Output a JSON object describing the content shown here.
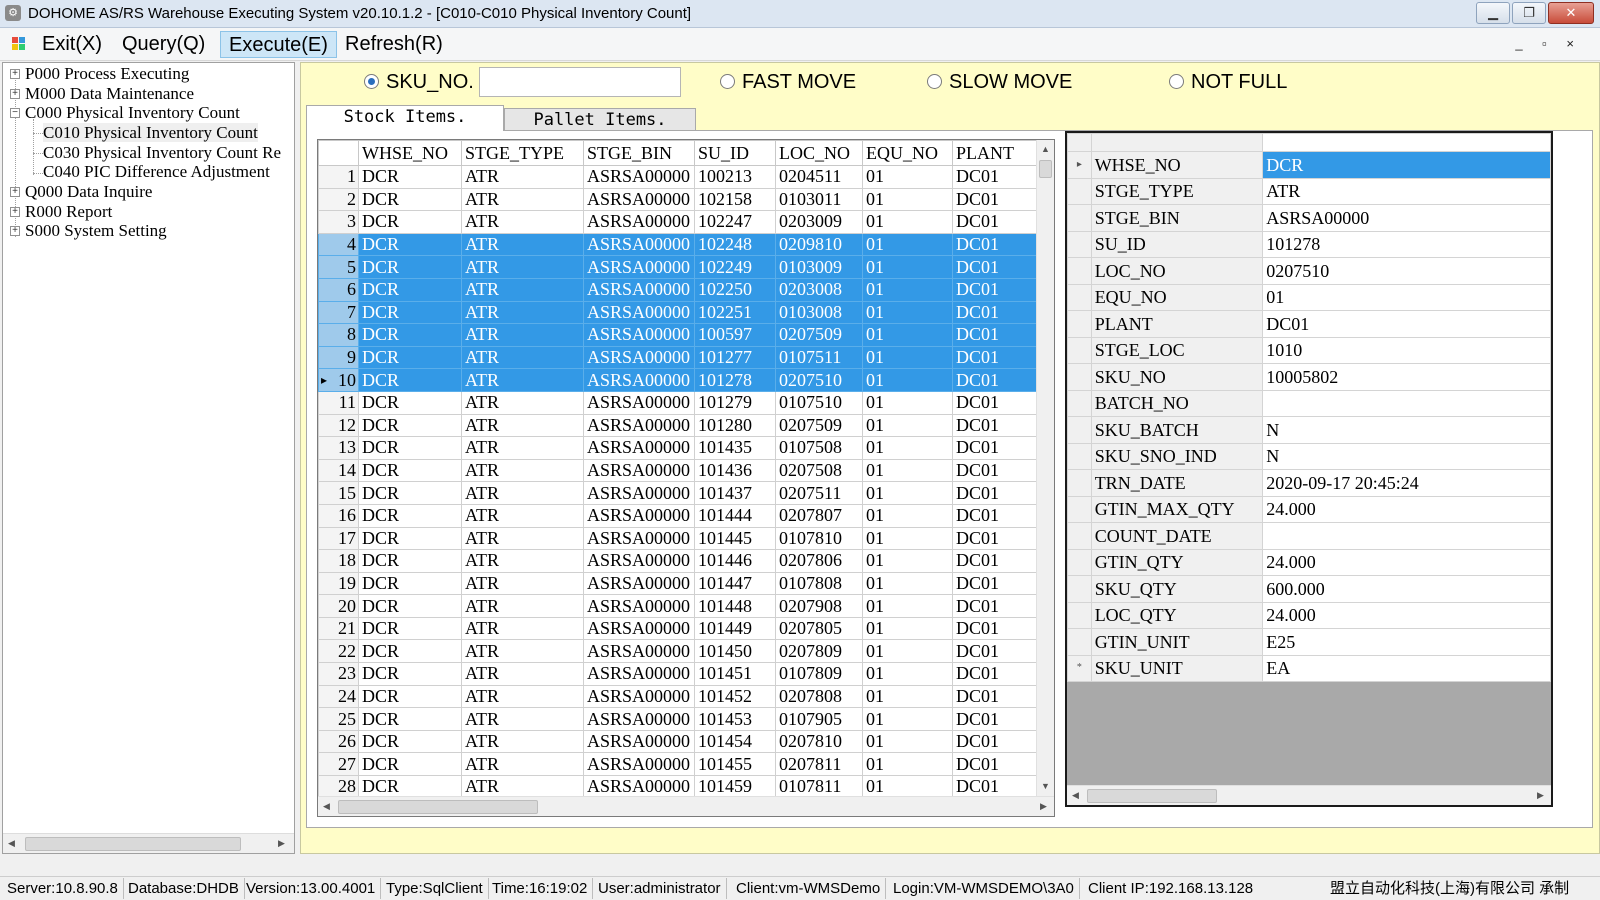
{
  "window": {
    "title": "DOHOME AS/RS Warehouse Executing System v20.10.1.2 - [C010-C010 Physical Inventory Count]",
    "app_icon": "app-logo-icon",
    "buttons": {
      "minimize": "minimize-icon",
      "maximize": "restore-icon",
      "close": "close-icon"
    }
  },
  "menu": {
    "icon": "menu-app-icon",
    "items": [
      {
        "label": "Exit(X)"
      },
      {
        "label": "Query(Q)"
      },
      {
        "label": "Execute(E)",
        "active": true
      },
      {
        "label": "Refresh(R)"
      }
    ],
    "mdi_controls": "_ ▫ ×"
  },
  "tree": {
    "nodes": [
      {
        "label": "P000 Process Executing",
        "expander": "+"
      },
      {
        "label": "M000 Data Maintenance",
        "expander": "+"
      },
      {
        "label": "C000 Physical Inventory Count",
        "expander": "−"
      },
      {
        "label": "C010 Physical Inventory Count",
        "child": true
      },
      {
        "label": "C030 Physical Inventory Count Re",
        "child": true
      },
      {
        "label": "C040 PIC Difference Adjustment",
        "child": true
      },
      {
        "label": "Q000 Data Inquire",
        "expander": "+"
      },
      {
        "label": "R000 Report",
        "expander": "+"
      },
      {
        "label": "S000 System Setting",
        "expander": "+"
      }
    ]
  },
  "filters": {
    "sku_no": {
      "label": "SKU_NO.",
      "checked": true,
      "value": ""
    },
    "fast_move": {
      "label": "FAST MOVE",
      "checked": false
    },
    "slow_move": {
      "label": "SLOW MOVE",
      "checked": false
    },
    "not_full": {
      "label": "NOT FULL",
      "checked": false
    }
  },
  "tabs": [
    {
      "label": "Stock Items.",
      "active": true
    },
    {
      "label": "Pallet Items.",
      "active": false
    }
  ],
  "grid": {
    "columns": [
      "WHSE_NO",
      "STGE_TYPE",
      "STGE_BIN",
      "SU_ID",
      "LOC_NO",
      "EQU_NO",
      "PLANT"
    ],
    "current_row_marker": "▸",
    "rows": [
      {
        "n": "1",
        "selected": false,
        "cells": [
          "DCR",
          "ATR",
          "ASRSA00000",
          "100213",
          "0204511",
          "01",
          "DC01"
        ]
      },
      {
        "n": "2",
        "selected": false,
        "cells": [
          "DCR",
          "ATR",
          "ASRSA00000",
          "102158",
          "0103011",
          "01",
          "DC01"
        ]
      },
      {
        "n": "3",
        "selected": false,
        "cells": [
          "DCR",
          "ATR",
          "ASRSA00000",
          "102247",
          "0203009",
          "01",
          "DC01"
        ]
      },
      {
        "n": "4",
        "selected": true,
        "cells": [
          "DCR",
          "ATR",
          "ASRSA00000",
          "102248",
          "0209810",
          "01",
          "DC01"
        ]
      },
      {
        "n": "5",
        "selected": true,
        "cells": [
          "DCR",
          "ATR",
          "ASRSA00000",
          "102249",
          "0103009",
          "01",
          "DC01"
        ]
      },
      {
        "n": "6",
        "selected": true,
        "cells": [
          "DCR",
          "ATR",
          "ASRSA00000",
          "102250",
          "0203008",
          "01",
          "DC01"
        ]
      },
      {
        "n": "7",
        "selected": true,
        "cells": [
          "DCR",
          "ATR",
          "ASRSA00000",
          "102251",
          "0103008",
          "01",
          "DC01"
        ]
      },
      {
        "n": "8",
        "selected": true,
        "cells": [
          "DCR",
          "ATR",
          "ASRSA00000",
          "100597",
          "0207509",
          "01",
          "DC01"
        ]
      },
      {
        "n": "9",
        "selected": true,
        "cells": [
          "DCR",
          "ATR",
          "ASRSA00000",
          "101277",
          "0107511",
          "01",
          "DC01"
        ]
      },
      {
        "n": "10",
        "selected": true,
        "current": true,
        "cells": [
          "DCR",
          "ATR",
          "ASRSA00000",
          "101278",
          "0207510",
          "01",
          "DC01"
        ]
      },
      {
        "n": "11",
        "selected": false,
        "cells": [
          "DCR",
          "ATR",
          "ASRSA00000",
          "101279",
          "0107510",
          "01",
          "DC01"
        ]
      },
      {
        "n": "12",
        "selected": false,
        "cells": [
          "DCR",
          "ATR",
          "ASRSA00000",
          "101280",
          "0207509",
          "01",
          "DC01"
        ]
      },
      {
        "n": "13",
        "selected": false,
        "cells": [
          "DCR",
          "ATR",
          "ASRSA00000",
          "101435",
          "0107508",
          "01",
          "DC01"
        ]
      },
      {
        "n": "14",
        "selected": false,
        "cells": [
          "DCR",
          "ATR",
          "ASRSA00000",
          "101436",
          "0207508",
          "01",
          "DC01"
        ]
      },
      {
        "n": "15",
        "selected": false,
        "cells": [
          "DCR",
          "ATR",
          "ASRSA00000",
          "101437",
          "0207511",
          "01",
          "DC01"
        ]
      },
      {
        "n": "16",
        "selected": false,
        "cells": [
          "DCR",
          "ATR",
          "ASRSA00000",
          "101444",
          "0207807",
          "01",
          "DC01"
        ]
      },
      {
        "n": "17",
        "selected": false,
        "cells": [
          "DCR",
          "ATR",
          "ASRSA00000",
          "101445",
          "0107810",
          "01",
          "DC01"
        ]
      },
      {
        "n": "18",
        "selected": false,
        "cells": [
          "DCR",
          "ATR",
          "ASRSA00000",
          "101446",
          "0207806",
          "01",
          "DC01"
        ]
      },
      {
        "n": "19",
        "selected": false,
        "cells": [
          "DCR",
          "ATR",
          "ASRSA00000",
          "101447",
          "0107808",
          "01",
          "DC01"
        ]
      },
      {
        "n": "20",
        "selected": false,
        "cells": [
          "DCR",
          "ATR",
          "ASRSA00000",
          "101448",
          "0207908",
          "01",
          "DC01"
        ]
      },
      {
        "n": "21",
        "selected": false,
        "cells": [
          "DCR",
          "ATR",
          "ASRSA00000",
          "101449",
          "0207805",
          "01",
          "DC01"
        ]
      },
      {
        "n": "22",
        "selected": false,
        "cells": [
          "DCR",
          "ATR",
          "ASRSA00000",
          "101450",
          "0207809",
          "01",
          "DC01"
        ]
      },
      {
        "n": "23",
        "selected": false,
        "cells": [
          "DCR",
          "ATR",
          "ASRSA00000",
          "101451",
          "0107809",
          "01",
          "DC01"
        ]
      },
      {
        "n": "24",
        "selected": false,
        "cells": [
          "DCR",
          "ATR",
          "ASRSA00000",
          "101452",
          "0207808",
          "01",
          "DC01"
        ]
      },
      {
        "n": "25",
        "selected": false,
        "cells": [
          "DCR",
          "ATR",
          "ASRSA00000",
          "101453",
          "0107905",
          "01",
          "DC01"
        ]
      },
      {
        "n": "26",
        "selected": false,
        "cells": [
          "DCR",
          "ATR",
          "ASRSA00000",
          "101454",
          "0207810",
          "01",
          "DC01"
        ]
      },
      {
        "n": "27",
        "selected": false,
        "cells": [
          "DCR",
          "ATR",
          "ASRSA00000",
          "101455",
          "0207811",
          "01",
          "DC01"
        ]
      },
      {
        "n": "28",
        "selected": false,
        "cells": [
          "DCR",
          "ATR",
          "ASRSA00000",
          "101459",
          "0107811",
          "01",
          "DC01"
        ]
      }
    ]
  },
  "properties": {
    "current_marker": "▸",
    "new_row_marker": "*",
    "rows": [
      {
        "key": "WHSE_NO",
        "value": "DCR",
        "selected": true
      },
      {
        "key": "STGE_TYPE",
        "value": "ATR"
      },
      {
        "key": "STGE_BIN",
        "value": "ASRSA00000"
      },
      {
        "key": "SU_ID",
        "value": "101278"
      },
      {
        "key": "LOC_NO",
        "value": "0207510"
      },
      {
        "key": "EQU_NO",
        "value": "01"
      },
      {
        "key": "PLANT",
        "value": "DC01"
      },
      {
        "key": "STGE_LOC",
        "value": "1010"
      },
      {
        "key": "SKU_NO",
        "value": "10005802"
      },
      {
        "key": "BATCH_NO",
        "value": ""
      },
      {
        "key": "SKU_BATCH",
        "value": "N"
      },
      {
        "key": "SKU_SNO_IND",
        "value": "N"
      },
      {
        "key": "TRN_DATE",
        "value": "2020-09-17 20:45:24"
      },
      {
        "key": "GTIN_MAX_QTY",
        "value": "24.000"
      },
      {
        "key": "COUNT_DATE",
        "value": ""
      },
      {
        "key": "GTIN_QTY",
        "value": "24.000"
      },
      {
        "key": "SKU_QTY",
        "value": "600.000"
      },
      {
        "key": "LOC_QTY",
        "value": "24.000"
      },
      {
        "key": "GTIN_UNIT",
        "value": "E25"
      },
      {
        "key": "SKU_UNIT",
        "value": "EA"
      }
    ]
  },
  "status": {
    "server": "Server:10.8.90.8",
    "database": "Database:DHDB",
    "version": "Version:13.00.4001",
    "type": "Type:SqlClient",
    "time": "Time:16:19:02",
    "user": "User:administrator",
    "client": "Client:vm-WMSDemo",
    "login": "Login:VM-WMSDEMO\\3A0",
    "client_ip": "Client IP:192.168.13.128",
    "vendor": "盟立自动化科技(上海)有限公司 承制"
  },
  "colors": {
    "selection": "#3399e6",
    "content_bg": "#fffdc8",
    "titlebar": "#dce6f2"
  }
}
